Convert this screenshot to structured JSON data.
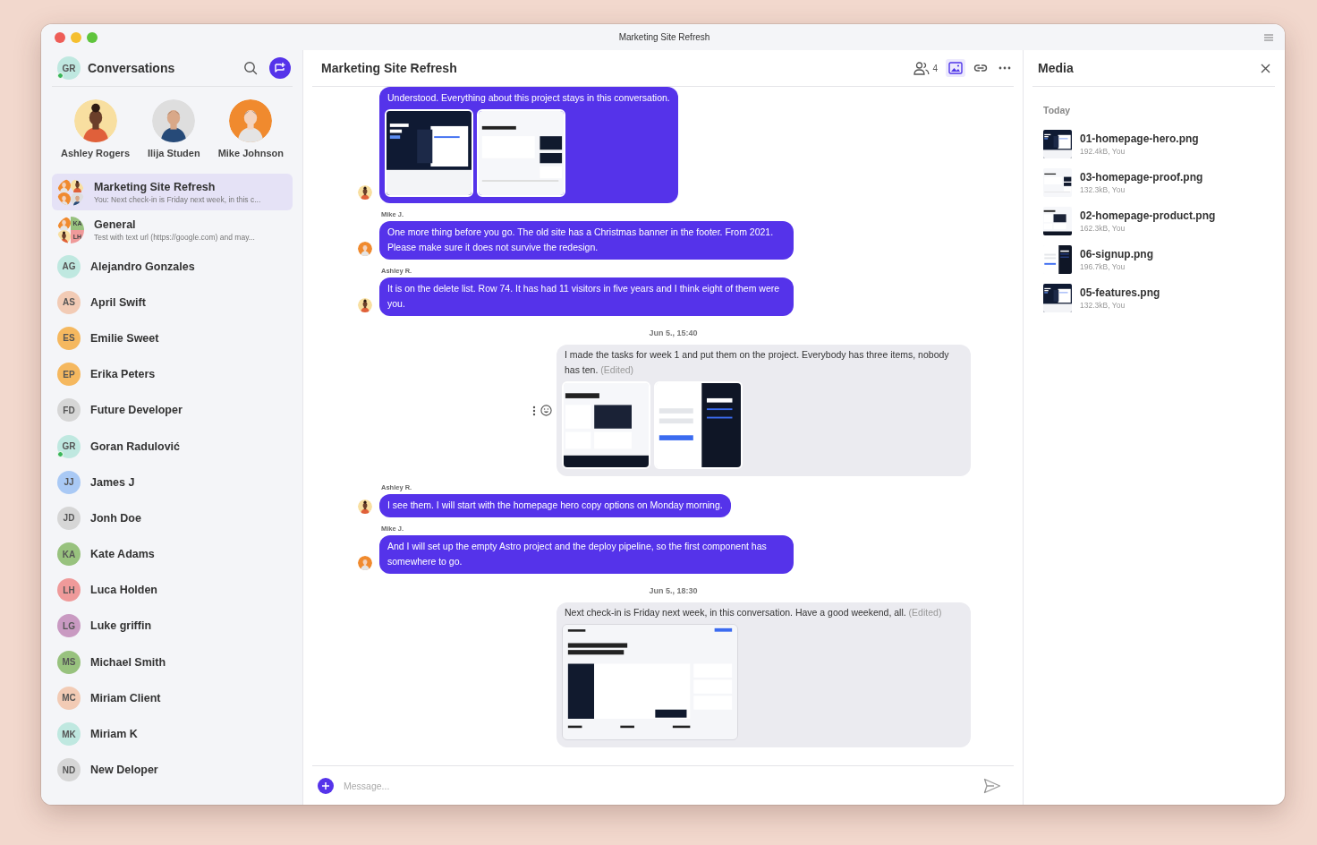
{
  "window": {
    "title": "Marketing Site Refresh"
  },
  "sidebar": {
    "user": {
      "initials": "GR",
      "color": "#bfe8e0",
      "online": true
    },
    "title": "Conversations",
    "stories": [
      {
        "name": "Ashley Rogers",
        "kind": "bun",
        "color": "#f8dfa0"
      },
      {
        "name": "Ilija Studen",
        "kind": "short",
        "color": "#dedede"
      },
      {
        "name": "Mike Johnson",
        "kind": "curly",
        "color": "#f08a2e"
      }
    ],
    "conversations": [
      {
        "kind": "group",
        "title": "Marketing Site Refresh",
        "preview": "You: Next check-in is Friday next week, in this c...",
        "selected": true
      },
      {
        "kind": "group",
        "title": "General",
        "preview": "Test with text url (https://google.com) and may...",
        "selected": false,
        "tiles": [
          "KA",
          "LH"
        ]
      },
      {
        "kind": "contact",
        "initials": "AG",
        "title": "Alejandro Gonzales",
        "color": "#bfe8e0",
        "online": false,
        "selected": false
      },
      {
        "kind": "contact",
        "initials": "AS",
        "title": "April Swift",
        "color": "#f2cbb5",
        "online": false,
        "selected": false
      },
      {
        "kind": "contact",
        "initials": "ES",
        "title": "Emilie Sweet",
        "color": "#f5b85f",
        "online": false,
        "selected": false
      },
      {
        "kind": "contact",
        "initials": "EP",
        "title": "Erika Peters",
        "color": "#f5b85f",
        "online": false,
        "selected": false
      },
      {
        "kind": "contact",
        "initials": "FD",
        "title": "Future Developer",
        "color": "#d6d6d6",
        "online": false,
        "selected": false
      },
      {
        "kind": "contact",
        "initials": "GR",
        "title": "Goran Radulović",
        "color": "#bfe8e0",
        "online": true,
        "selected": false
      },
      {
        "kind": "contact",
        "initials": "JJ",
        "title": "James J",
        "color": "#a9c9f5",
        "online": false,
        "selected": false
      },
      {
        "kind": "contact",
        "initials": "JD",
        "title": "Jonh Doe",
        "color": "#d6d6d6",
        "online": false,
        "selected": false
      },
      {
        "kind": "contact",
        "initials": "KA",
        "title": "Kate Adams",
        "color": "#98c27e",
        "online": false,
        "selected": false
      },
      {
        "kind": "contact",
        "initials": "LH",
        "title": "Luca Holden",
        "color": "#ef9a9a",
        "online": false,
        "selected": false
      },
      {
        "kind": "contact",
        "initials": "LG",
        "title": "Luke griffin",
        "color": "#c99ac2",
        "online": false,
        "selected": false
      },
      {
        "kind": "contact",
        "initials": "MS",
        "title": "Michael Smith",
        "color": "#98c27e",
        "online": false,
        "selected": false
      },
      {
        "kind": "contact",
        "initials": "MC",
        "title": "Miriam Client",
        "color": "#f2cbb5",
        "online": false,
        "selected": false
      },
      {
        "kind": "contact",
        "initials": "MK",
        "title": "Miriam K",
        "color": "#bfe8e0",
        "online": false,
        "selected": false
      },
      {
        "kind": "contact",
        "initials": "ND",
        "title": "New Deloper",
        "color": "#d6d6d6",
        "online": false,
        "selected": false
      }
    ]
  },
  "chat": {
    "title": "Marketing Site Refresh",
    "toolbar": [
      {
        "kind": "members",
        "label": "4",
        "selected": false
      },
      {
        "kind": "media",
        "selected": true
      },
      {
        "kind": "links",
        "selected": false
      },
      {
        "kind": "more",
        "selected": false
      }
    ],
    "messages": [
      {
        "kind": "message",
        "mine": false,
        "author": {
          "kind": "bun",
          "color": "#f8dfa0"
        },
        "text": "Understood. Everything about this project stays in this conversation.",
        "show_actions": false
      },
      {
        "kind": "message",
        "mine": false,
        "sender": "Mike J.",
        "author": {
          "kind": "curly",
          "color": "#f08a2e"
        },
        "text": "One more thing before you go. The old site has a Christmas banner in the footer. From 2021. Please make sure it does not survive the redesign.",
        "show_actions": false
      },
      {
        "kind": "message",
        "mine": false,
        "sender": "Ashley R.",
        "author": {
          "kind": "bun",
          "color": "#f8dfa0"
        },
        "text": "It is on the delete list. Row 74. It has had 11 visitors in five years and I think eight of them were you.",
        "show_actions": false
      },
      {
        "kind": "date",
        "text": "Jun 5., 15:40"
      },
      {
        "kind": "message",
        "mine": true,
        "text": "I made the tasks for week 1 and put them on the project. Everybody has three items, nobody has ten.",
        "edited": "(Edited)",
        "show_actions": true
      },
      {
        "kind": "message",
        "mine": false,
        "sender": "Ashley R.",
        "author": {
          "kind": "bun",
          "color": "#f8dfa0"
        },
        "text": "I see them. I will start with the homepage hero copy options on Monday morning.",
        "show_actions": false
      },
      {
        "kind": "message",
        "mine": false,
        "sender": "Mike J.",
        "author": {
          "kind": "curly",
          "color": "#f08a2e"
        },
        "text": "And I will set up the empty Astro project and the deploy pipeline, so the first component has somewhere to go.",
        "show_actions": false
      },
      {
        "kind": "date",
        "text": "Jun 5., 18:30"
      },
      {
        "kind": "message",
        "mine": true,
        "text": "Next check-in is Friday next week, in this conversation. Have a good weekend, all.",
        "edited": "(Edited)",
        "show_actions": false
      }
    ],
    "composer": {
      "placeholder": "Message..."
    }
  },
  "media": {
    "title": "Media",
    "sections": [
      {
        "label": "Today",
        "files": [
          {
            "name": "01-homepage-hero.png",
            "meta": "192.4kB, You"
          },
          {
            "name": "03-homepage-proof.png",
            "meta": "132.3kB, You"
          },
          {
            "name": "02-homepage-product.png",
            "meta": "162.3kB, You"
          },
          {
            "name": "06-signup.png",
            "meta": "196.7kB, You"
          },
          {
            "name": "05-features.png",
            "meta": "132.3kB, You"
          }
        ]
      }
    ]
  }
}
